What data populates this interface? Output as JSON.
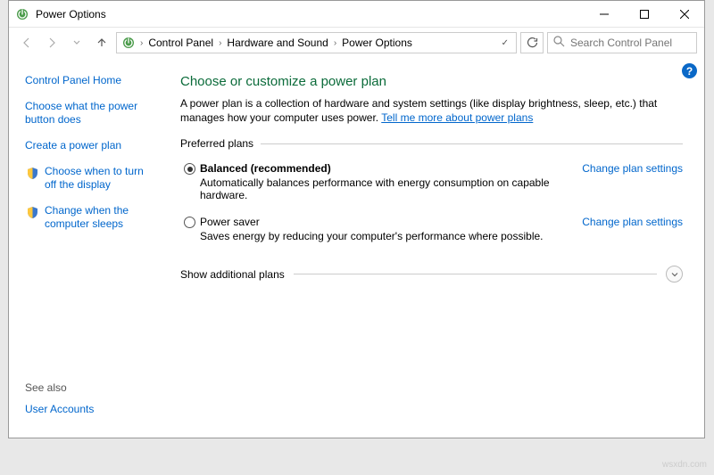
{
  "titlebar": {
    "title": "Power Options"
  },
  "breadcrumbs": {
    "items": [
      "Control Panel",
      "Hardware and Sound",
      "Power Options"
    ]
  },
  "search": {
    "placeholder": "Search Control Panel"
  },
  "sidebar": {
    "home": "Control Panel Home",
    "links": [
      "Choose what the power button does",
      "Create a power plan",
      "Choose when to turn off the display",
      "Change when the computer sleeps"
    ]
  },
  "main": {
    "heading": "Choose or customize a power plan",
    "desc_pre": "A power plan is a collection of hardware and system settings (like display brightness, sleep, etc.) that manages how your computer uses power. ",
    "desc_link": "Tell me more about power plans",
    "preferred_legend": "Preferred plans",
    "plans": [
      {
        "name": "Balanced (recommended)",
        "desc": "Automatically balances performance with energy consumption on capable hardware.",
        "link": "Change plan settings",
        "selected": true
      },
      {
        "name": "Power saver",
        "desc": "Saves energy by reducing your computer's performance where possible.",
        "link": "Change plan settings",
        "selected": false
      }
    ],
    "show_additional": "Show additional plans"
  },
  "see_also": {
    "title": "See also",
    "links": [
      "User Accounts"
    ]
  },
  "watermark": "wsxdn.com"
}
